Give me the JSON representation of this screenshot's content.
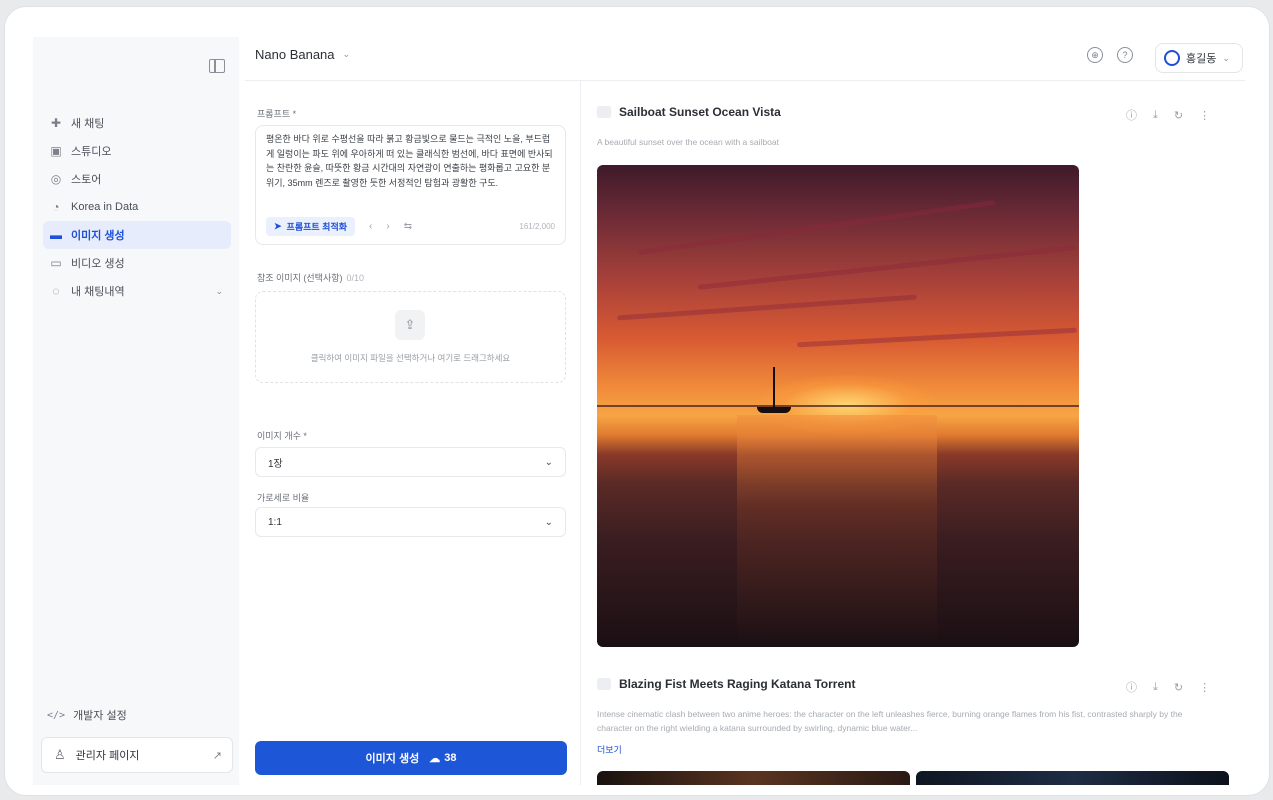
{
  "sidebar": {
    "items": [
      {
        "label": "새 채팅",
        "icon": "chat-plus-icon"
      },
      {
        "label": "스튜디오",
        "icon": "studio-icon"
      },
      {
        "label": "스토어",
        "icon": "store-icon"
      },
      {
        "label": "Korea in Data",
        "icon": "data-icon"
      },
      {
        "label": "이미지 생성",
        "icon": "image-icon",
        "active": true
      },
      {
        "label": "비디오 생성",
        "icon": "video-icon"
      },
      {
        "label": "내 채팅내역",
        "icon": "history-icon"
      }
    ],
    "developer_label": "개발자 설정",
    "admin_label": "관리자 페이지"
  },
  "header": {
    "model_name": "Nano Banana",
    "user_name": "홍길동"
  },
  "form": {
    "prompt_label": "프롬프트 *",
    "prompt_text": "평온한 바다 위로 수평선을 따라 붉고 황금빛으로 물드는 극적인 노을, 부드럽게 일렁이는 파도 위에 우아하게 떠 있는 클래식한 범선에, 바다 표면에 반사되는 찬란한 윤슬, 따뜻한 황금 시간대의 자연광이 연출하는 평화롭고 고요한 분위기, 35mm 렌즈로 촬영한 듯한 서정적인 탐험과 광활한 구도.",
    "enhance_label": "프롬프트 최적화",
    "char_count": "161/2,000",
    "ref_label": "참조 이미지 (선택사항)",
    "ref_hint": "0/10",
    "upload_text": "클릭하여 이미지 파일을 선택하거나 여기로 드래그하세요",
    "count_label": "이미지 개수 *",
    "count_value": "1장",
    "ratio_label": "가로세로 비율",
    "ratio_value": "1:1",
    "generate_label": "이미지 생성",
    "credits": "38"
  },
  "results": [
    {
      "title": "Sailboat Sunset Ocean Vista",
      "description": "A beautiful sunset over the ocean with a sailboat"
    },
    {
      "title": "Blazing Fist Meets Raging Katana Torrent",
      "description": "Intense cinematic clash between two anime heroes: the character on the left unleashes fierce, burning orange flames from his fist, contrasted sharply by the character on the right wielding a katana surrounded by swirling, dynamic blue water...",
      "more_label": "더보기"
    }
  ],
  "colors": {
    "accent": "#1d56d6",
    "active_nav_bg": "#e6ecfb"
  }
}
